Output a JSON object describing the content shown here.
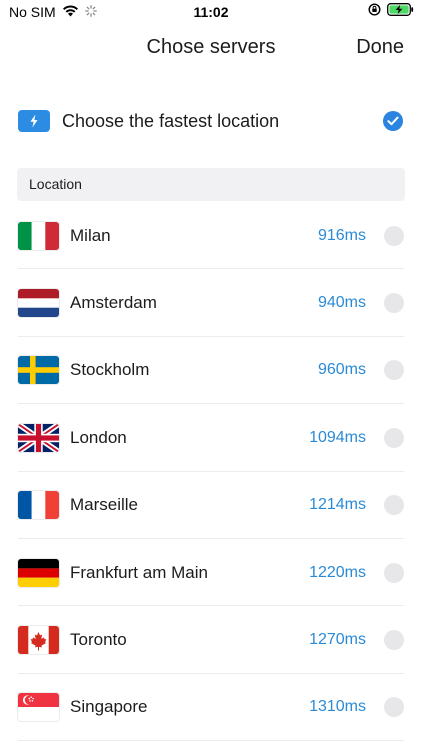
{
  "status_bar": {
    "carrier": "No SIM",
    "time": "11:02"
  },
  "nav": {
    "title": "Chose servers",
    "done_label": "Done"
  },
  "fastest": {
    "label": "Choose the fastest location",
    "selected": true
  },
  "section": {
    "title": "Location"
  },
  "colors": {
    "accent": "#2a84e0",
    "ping": "#2a8ad6",
    "radio_off": "#e7e7ea",
    "section_bg": "#f1f1f3"
  },
  "servers": [
    {
      "city": "Milan",
      "ping": "916ms",
      "flag": "italy-flag"
    },
    {
      "city": "Amsterdam",
      "ping": "940ms",
      "flag": "netherlands-flag"
    },
    {
      "city": "Stockholm",
      "ping": "960ms",
      "flag": "sweden-flag"
    },
    {
      "city": "London",
      "ping": "1094ms",
      "flag": "uk-flag"
    },
    {
      "city": "Marseille",
      "ping": "1214ms",
      "flag": "france-flag"
    },
    {
      "city": "Frankfurt am Main",
      "ping": "1220ms",
      "flag": "germany-flag"
    },
    {
      "city": "Toronto",
      "ping": "1270ms",
      "flag": "canada-flag"
    },
    {
      "city": "Singapore",
      "ping": "1310ms",
      "flag": "singapore-flag"
    }
  ]
}
